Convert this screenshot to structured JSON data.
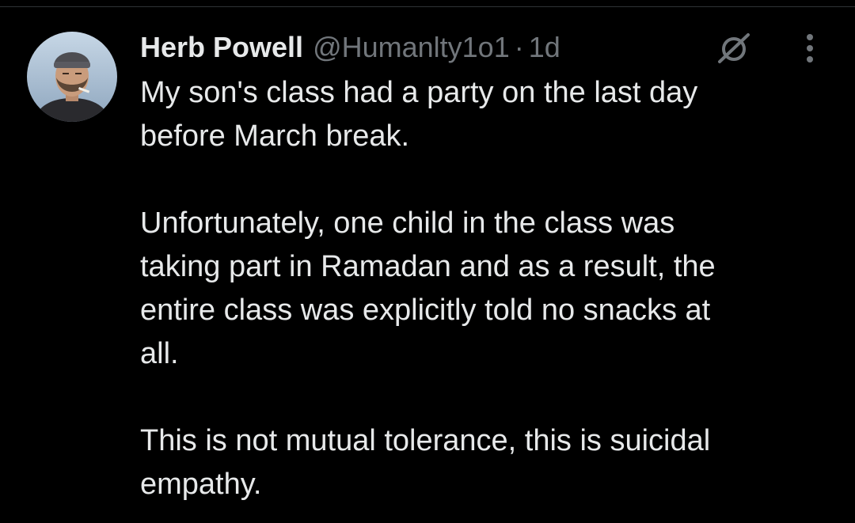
{
  "tweet": {
    "author": {
      "display_name": "Herb Powell",
      "handle": "@Humanlty1o1",
      "avatar_icon": "profile-photo"
    },
    "separator": "·",
    "timestamp": "1d",
    "paragraphs": [
      "My son's class had a party on the last day\nbefore March break.",
      "Unfortunately, one child in the class was\ntaking part in Ramadan and as a result, the\nentire class was explicitly told no snacks at\nall.",
      "This is not mutual tolerance, this is suicidal\nempathy."
    ],
    "actions": {
      "grok_icon": "grok-slash-circle-icon",
      "more_icon": "more-vertical-icon"
    }
  },
  "colors": {
    "background": "#000000",
    "text_primary": "#e7e9ea",
    "text_secondary": "#71767b",
    "divider": "#2f3336"
  }
}
